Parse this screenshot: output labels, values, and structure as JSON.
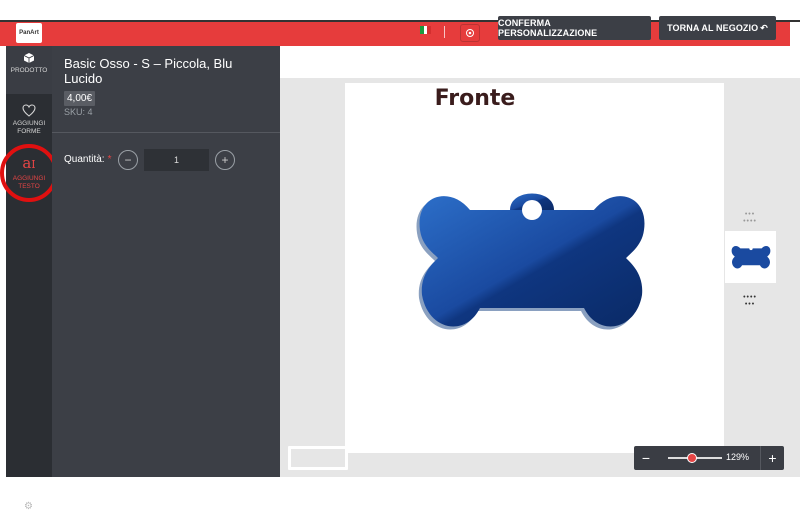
{
  "header": {
    "logo_text": "PanArt",
    "confirm_label": "CONFERMA PERSONALIZZAZIONE",
    "shop_label": "TORNA AL NEGOZIO",
    "brand_color": "#e63c3c"
  },
  "rail": {
    "items": [
      {
        "label": "PRODOTTO",
        "icon": "cube-icon"
      },
      {
        "label": "AGGIUNGI FORME",
        "icon": "heart-icon"
      },
      {
        "label": "AGGIUNGI TESTO",
        "icon": "text-icon"
      }
    ]
  },
  "product": {
    "title": "Basic Osso - S – Piccola, Blu Lucido",
    "price": "4,00€",
    "sku": "SKU: 4",
    "quantity_label": "Quantità:",
    "required_mark": "*",
    "quantity": "1"
  },
  "canvas": {
    "side_label": "Fronte",
    "tag_color": "#1a4aa0"
  },
  "zoom": {
    "value": "129%",
    "level_percent": 129
  }
}
